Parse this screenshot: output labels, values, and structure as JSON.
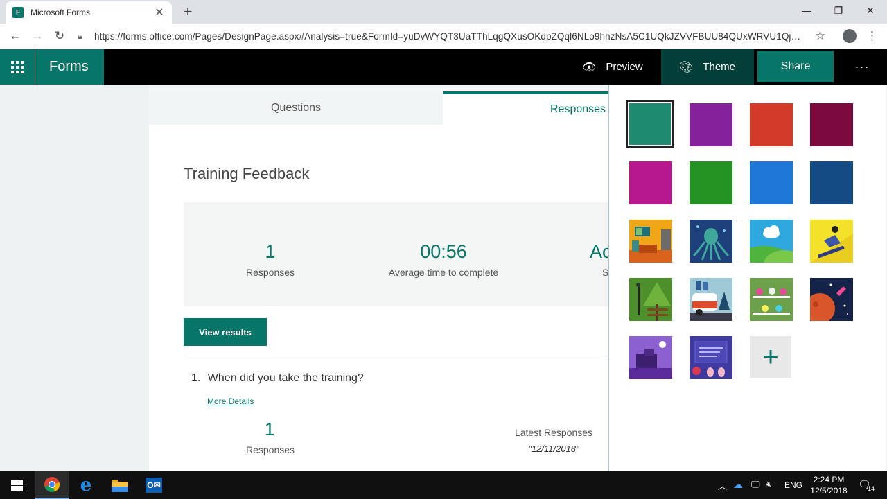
{
  "browser": {
    "tab_title": "Microsoft Forms",
    "tab_favicon": "F",
    "url": "https://forms.office.com/Pages/DesignPage.aspx#Analysis=true&FormId=yuDvWYQT3UaTThLqgQXusOKdpZQql6NLo9hhzNsA5C1UQkJZVVFBUU84QUxWRVU1QjF..."
  },
  "appbar": {
    "brand": "Forms",
    "preview_label": "Preview",
    "theme_label": "Theme",
    "share_label": "Share",
    "more_label": "···"
  },
  "tabs": {
    "questions": "Questions",
    "responses": "Responses"
  },
  "form": {
    "title": "Training Feedback",
    "stats": [
      {
        "value": "1",
        "label": "Responses"
      },
      {
        "value": "00:56",
        "label": "Average time to complete"
      },
      {
        "value": "Ac",
        "label": "S"
      }
    ],
    "view_results": "View results",
    "question": {
      "number": "1.",
      "text": "When did you take the training?",
      "more_details": "More Details",
      "responses_count": "1",
      "responses_label": "Responses",
      "latest_label": "Latest Responses",
      "latest_value": "\"12/11/2018\""
    }
  },
  "theme_panel": {
    "colors": [
      "#1e8a70",
      "#85229b",
      "#d23b29",
      "#7c0a3e",
      "#b8188e",
      "#249324",
      "#1f78d8",
      "#144b85"
    ],
    "selected_index": 0,
    "picture_themes": [
      "living-room",
      "octopus",
      "cloud-hills",
      "snowboarder",
      "park-bench",
      "camper-van",
      "science-lab",
      "space-planet",
      "desk-clock",
      "chalkboard"
    ],
    "add_label": "+"
  },
  "taskbar": {
    "lang": "ENG",
    "time": "2:24 PM",
    "date": "12/5/2018",
    "notifications": "14"
  }
}
